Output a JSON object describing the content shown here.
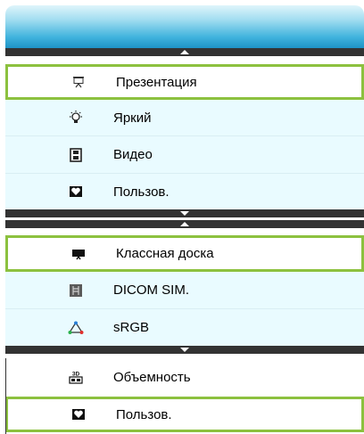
{
  "menu": {
    "section1": {
      "items": [
        {
          "label": "Презентация",
          "icon": "presentation-screen-icon",
          "state": "selected"
        },
        {
          "label": "Яркий",
          "icon": "bright-bulb-icon"
        },
        {
          "label": "Видео",
          "icon": "film-icon"
        },
        {
          "label": "Пользов.",
          "icon": "user-heart-icon"
        }
      ]
    },
    "section2": {
      "items": [
        {
          "label": "Классная доска",
          "icon": "blackboard-icon",
          "state": "selected"
        },
        {
          "label": "DICOM SIM.",
          "icon": "xray-icon"
        },
        {
          "label": "sRGB",
          "icon": "srgb-triangle-icon"
        }
      ]
    },
    "section3": {
      "items": [
        {
          "label": "Объемность",
          "icon": "3d-icon"
        },
        {
          "label": "Пользов.",
          "icon": "user-heart-icon",
          "state": "selected"
        }
      ]
    },
    "colors": {
      "header_top": "#dff5fb",
      "header_bottom": "#1e93c6",
      "item_bg": "#e9fbff",
      "selection_border": "#8cc13f",
      "scrollbar": "#333333"
    }
  }
}
